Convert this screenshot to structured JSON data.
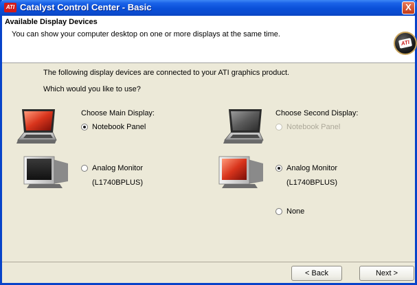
{
  "window": {
    "title": "Catalyst Control Center - Basic",
    "logo_text": "ATI",
    "close_glyph": "X"
  },
  "header": {
    "title": "Available Display Devices",
    "subtitle": "You can show your computer desktop on one or more displays at the same time.",
    "badge_text": "ATI"
  },
  "intro": {
    "line1": "The following display devices are connected to your ATI graphics product.",
    "line2": "Which would you like to use?"
  },
  "main_display": {
    "heading": "Choose Main Display:",
    "options": [
      {
        "label": "Notebook Panel",
        "checked": true,
        "disabled": false,
        "icon": "laptop-icon"
      },
      {
        "label": "Analog Monitor",
        "sublabel": "(L1740BPLUS)",
        "checked": false,
        "disabled": false,
        "icon": "monitor-icon"
      }
    ]
  },
  "second_display": {
    "heading": "Choose Second Display:",
    "options": [
      {
        "label": "Notebook Panel",
        "checked": false,
        "disabled": true,
        "icon": "laptop-icon"
      },
      {
        "label": "Analog Monitor",
        "sublabel": "(L1740BPLUS)",
        "checked": true,
        "disabled": false,
        "icon": "monitor-icon"
      },
      {
        "label": "None",
        "checked": false,
        "disabled": false
      }
    ]
  },
  "buttons": {
    "back": "< Back",
    "next": "Next >"
  },
  "colors": {
    "titlebar": "#0a4fd8",
    "dialog": "#ece9d8",
    "ati_red": "#d21b1b"
  }
}
